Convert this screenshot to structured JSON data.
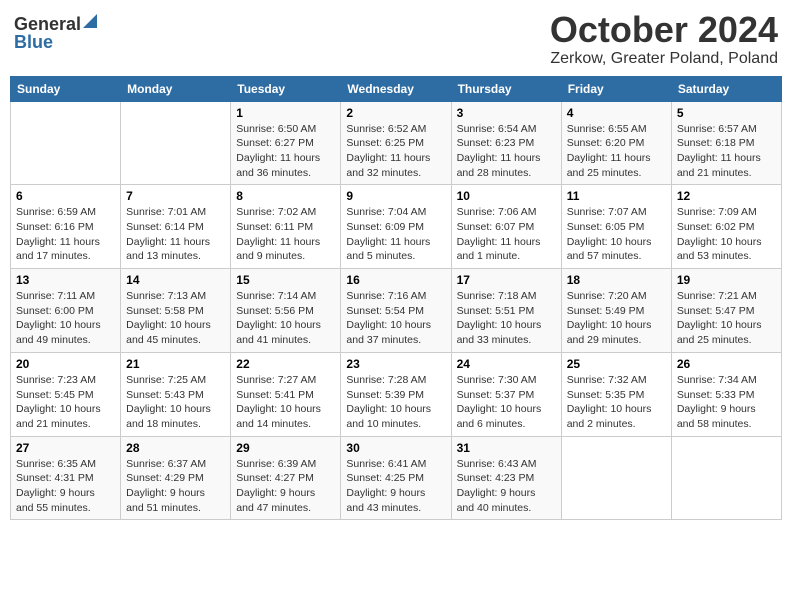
{
  "header": {
    "logo_general": "General",
    "logo_blue": "Blue",
    "month": "October 2024",
    "location": "Zerkow, Greater Poland, Poland"
  },
  "days_of_week": [
    "Sunday",
    "Monday",
    "Tuesday",
    "Wednesday",
    "Thursday",
    "Friday",
    "Saturday"
  ],
  "weeks": [
    [
      {
        "day": "",
        "info": ""
      },
      {
        "day": "",
        "info": ""
      },
      {
        "day": "1",
        "info": "Sunrise: 6:50 AM\nSunset: 6:27 PM\nDaylight: 11 hours and 36 minutes."
      },
      {
        "day": "2",
        "info": "Sunrise: 6:52 AM\nSunset: 6:25 PM\nDaylight: 11 hours and 32 minutes."
      },
      {
        "day": "3",
        "info": "Sunrise: 6:54 AM\nSunset: 6:23 PM\nDaylight: 11 hours and 28 minutes."
      },
      {
        "day": "4",
        "info": "Sunrise: 6:55 AM\nSunset: 6:20 PM\nDaylight: 11 hours and 25 minutes."
      },
      {
        "day": "5",
        "info": "Sunrise: 6:57 AM\nSunset: 6:18 PM\nDaylight: 11 hours and 21 minutes."
      }
    ],
    [
      {
        "day": "6",
        "info": "Sunrise: 6:59 AM\nSunset: 6:16 PM\nDaylight: 11 hours and 17 minutes."
      },
      {
        "day": "7",
        "info": "Sunrise: 7:01 AM\nSunset: 6:14 PM\nDaylight: 11 hours and 13 minutes."
      },
      {
        "day": "8",
        "info": "Sunrise: 7:02 AM\nSunset: 6:11 PM\nDaylight: 11 hours and 9 minutes."
      },
      {
        "day": "9",
        "info": "Sunrise: 7:04 AM\nSunset: 6:09 PM\nDaylight: 11 hours and 5 minutes."
      },
      {
        "day": "10",
        "info": "Sunrise: 7:06 AM\nSunset: 6:07 PM\nDaylight: 11 hours and 1 minute."
      },
      {
        "day": "11",
        "info": "Sunrise: 7:07 AM\nSunset: 6:05 PM\nDaylight: 10 hours and 57 minutes."
      },
      {
        "day": "12",
        "info": "Sunrise: 7:09 AM\nSunset: 6:02 PM\nDaylight: 10 hours and 53 minutes."
      }
    ],
    [
      {
        "day": "13",
        "info": "Sunrise: 7:11 AM\nSunset: 6:00 PM\nDaylight: 10 hours and 49 minutes."
      },
      {
        "day": "14",
        "info": "Sunrise: 7:13 AM\nSunset: 5:58 PM\nDaylight: 10 hours and 45 minutes."
      },
      {
        "day": "15",
        "info": "Sunrise: 7:14 AM\nSunset: 5:56 PM\nDaylight: 10 hours and 41 minutes."
      },
      {
        "day": "16",
        "info": "Sunrise: 7:16 AM\nSunset: 5:54 PM\nDaylight: 10 hours and 37 minutes."
      },
      {
        "day": "17",
        "info": "Sunrise: 7:18 AM\nSunset: 5:51 PM\nDaylight: 10 hours and 33 minutes."
      },
      {
        "day": "18",
        "info": "Sunrise: 7:20 AM\nSunset: 5:49 PM\nDaylight: 10 hours and 29 minutes."
      },
      {
        "day": "19",
        "info": "Sunrise: 7:21 AM\nSunset: 5:47 PM\nDaylight: 10 hours and 25 minutes."
      }
    ],
    [
      {
        "day": "20",
        "info": "Sunrise: 7:23 AM\nSunset: 5:45 PM\nDaylight: 10 hours and 21 minutes."
      },
      {
        "day": "21",
        "info": "Sunrise: 7:25 AM\nSunset: 5:43 PM\nDaylight: 10 hours and 18 minutes."
      },
      {
        "day": "22",
        "info": "Sunrise: 7:27 AM\nSunset: 5:41 PM\nDaylight: 10 hours and 14 minutes."
      },
      {
        "day": "23",
        "info": "Sunrise: 7:28 AM\nSunset: 5:39 PM\nDaylight: 10 hours and 10 minutes."
      },
      {
        "day": "24",
        "info": "Sunrise: 7:30 AM\nSunset: 5:37 PM\nDaylight: 10 hours and 6 minutes."
      },
      {
        "day": "25",
        "info": "Sunrise: 7:32 AM\nSunset: 5:35 PM\nDaylight: 10 hours and 2 minutes."
      },
      {
        "day": "26",
        "info": "Sunrise: 7:34 AM\nSunset: 5:33 PM\nDaylight: 9 hours and 58 minutes."
      }
    ],
    [
      {
        "day": "27",
        "info": "Sunrise: 6:35 AM\nSunset: 4:31 PM\nDaylight: 9 hours and 55 minutes."
      },
      {
        "day": "28",
        "info": "Sunrise: 6:37 AM\nSunset: 4:29 PM\nDaylight: 9 hours and 51 minutes."
      },
      {
        "day": "29",
        "info": "Sunrise: 6:39 AM\nSunset: 4:27 PM\nDaylight: 9 hours and 47 minutes."
      },
      {
        "day": "30",
        "info": "Sunrise: 6:41 AM\nSunset: 4:25 PM\nDaylight: 9 hours and 43 minutes."
      },
      {
        "day": "31",
        "info": "Sunrise: 6:43 AM\nSunset: 4:23 PM\nDaylight: 9 hours and 40 minutes."
      },
      {
        "day": "",
        "info": ""
      },
      {
        "day": "",
        "info": ""
      }
    ]
  ]
}
